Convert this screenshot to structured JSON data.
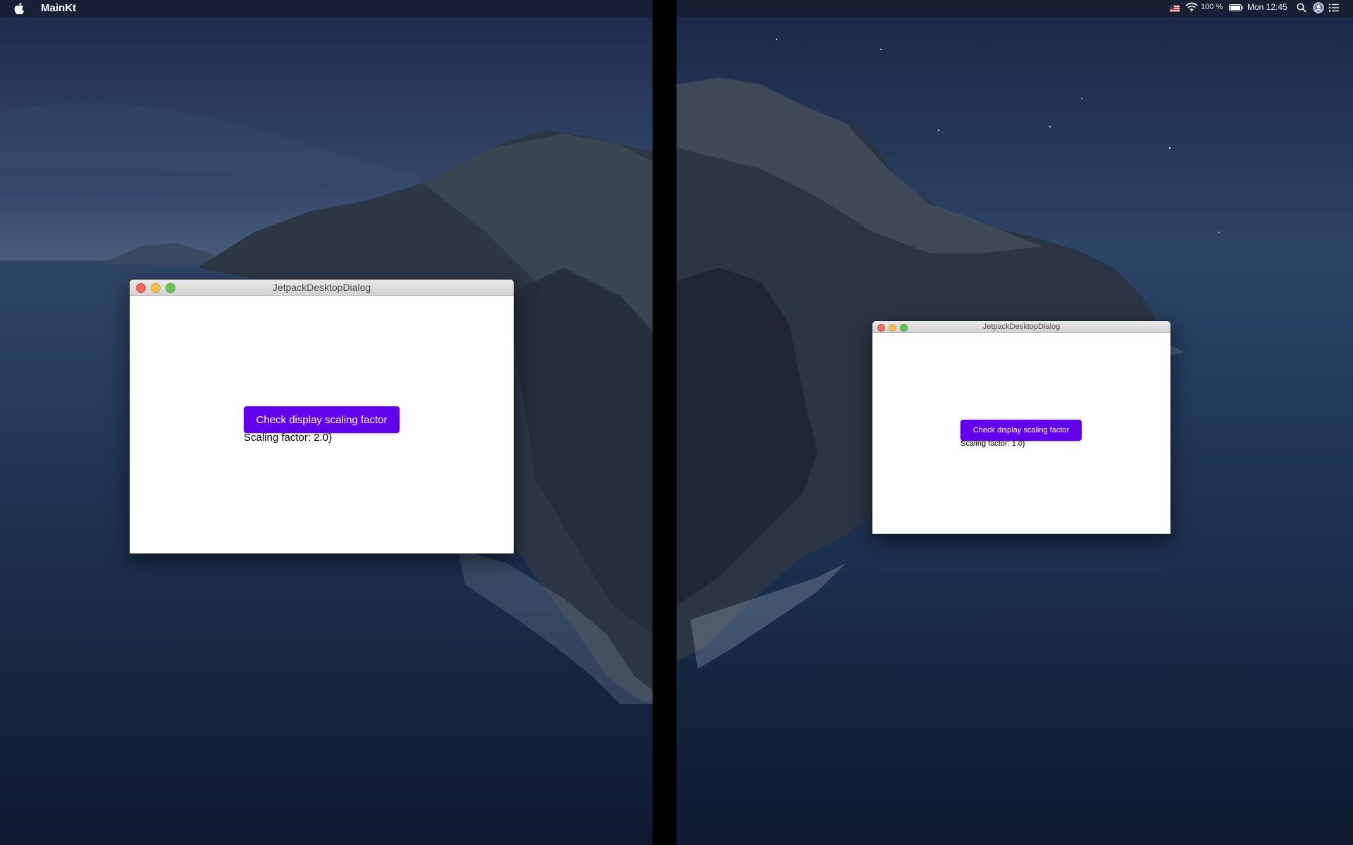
{
  "menubar": {
    "app_name": "MainKt",
    "battery": "100 %",
    "clock": "Mon 12:45",
    "icons": [
      "apple-icon",
      "flag-icon",
      "wifi-icon",
      "battery-icon",
      "search-icon",
      "user-icon",
      "list-icon"
    ]
  },
  "windows": [
    {
      "title": "JetpackDesktopDialog",
      "button_label": "Check display scaling factor",
      "scaling_text": "Scaling factor: 2.0}"
    },
    {
      "title": "JetpackDesktopDialog",
      "button_label": "Check display scaling factor",
      "scaling_text": "Scaling factor: 1.0}"
    }
  ],
  "colors": {
    "accent": "#6200ee",
    "traffic_close": "#ed6a5e",
    "traffic_minimize": "#f5bf4f",
    "traffic_maximize": "#61c554"
  }
}
